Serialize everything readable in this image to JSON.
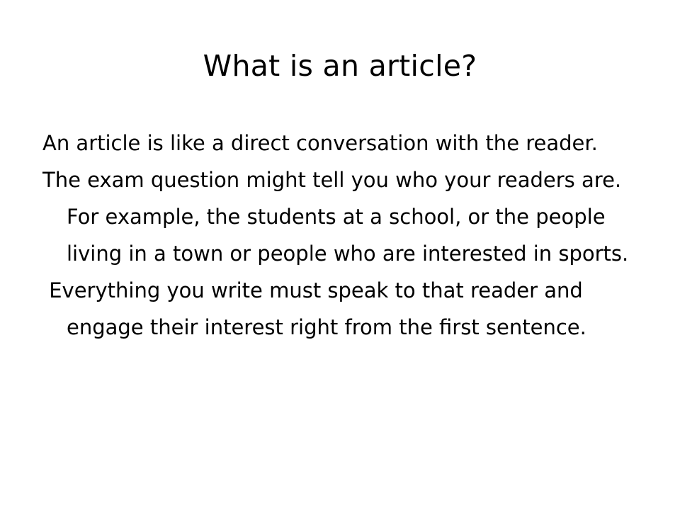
{
  "slide": {
    "title": "What is an article?",
    "paragraphs": [
      "An article is like a direct conversation with the reader.",
      "The exam question might tell you who your readers are. For example, the students at a school, or the people living in a town or people who are interested in sports.",
      " Everything you write must speak to that reader and engage their interest right from the first sentence."
    ]
  }
}
